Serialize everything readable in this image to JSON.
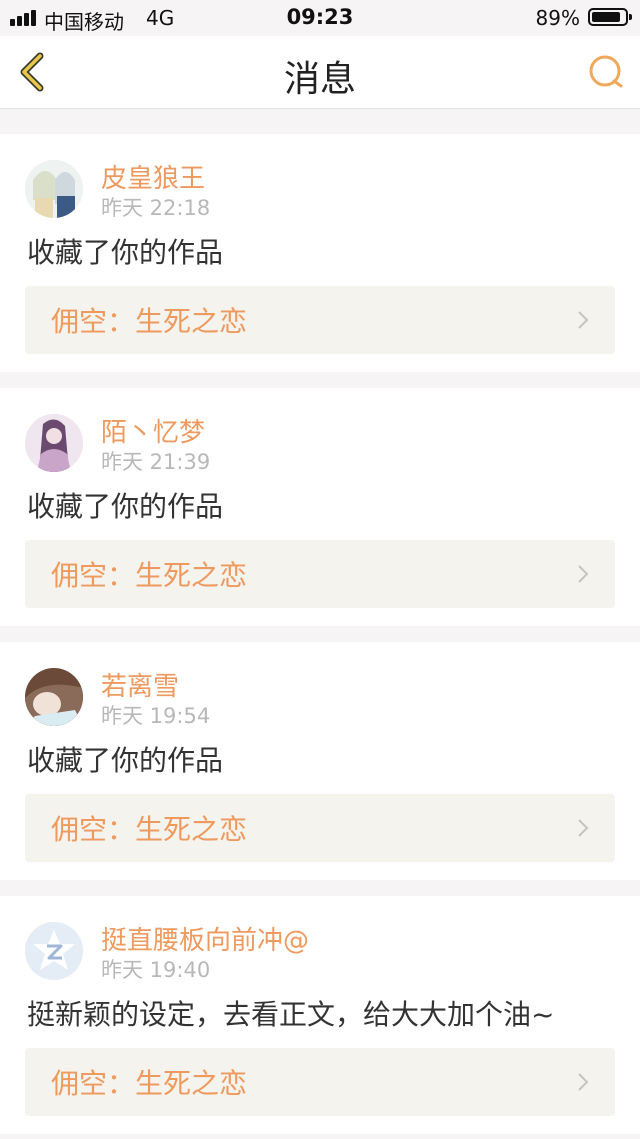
{
  "status_bar": {
    "carrier": "中国移动",
    "network": "4G",
    "time": "09:23",
    "battery": "89%",
    "battery_level": 0.89
  },
  "nav": {
    "title": "消息",
    "back_icon": "chevron-left-icon",
    "search_icon": "search-icon"
  },
  "colors": {
    "accent": "#ee9a5e",
    "nav_icon": "#e8b44a"
  },
  "messages": [
    {
      "user": "皮皇狼王",
      "time": "昨天 22:18",
      "content": "收藏了你的作品",
      "work": "佣空：生死之恋"
    },
    {
      "user": "陌丶忆梦",
      "time": "昨天 21:39",
      "content": "收藏了你的作品",
      "work": "佣空：生死之恋"
    },
    {
      "user": "若离雪",
      "time": "昨天 19:54",
      "content": "收藏了你的作品",
      "work": "佣空：生死之恋"
    },
    {
      "user": "挺直腰板向前冲@",
      "time": "昨天 19:40",
      "content": "挺新颖的设定，去看正文，给大大加个油~",
      "work": "佣空：生死之恋"
    }
  ]
}
